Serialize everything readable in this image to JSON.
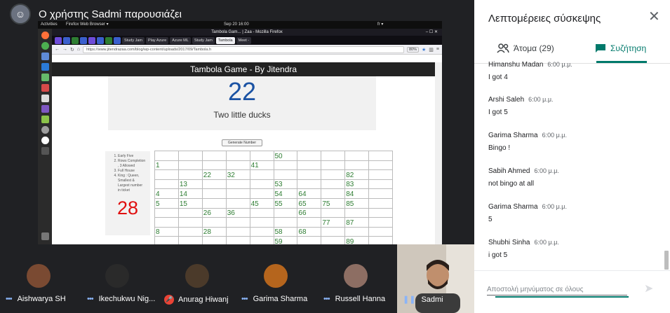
{
  "presenter": {
    "title": "Ο χρήστης Sadmi παρουσιάζει"
  },
  "desktop": {
    "activities": "Activities",
    "app_menu": "Firefox Web Browser ▾",
    "clock": "Sep 20  16:00",
    "lang": "fr ▾"
  },
  "browser": {
    "window_title": "Tambola Gam... | Zaa - Mozilla Firefox",
    "tabs": [
      "Study Jam",
      "Play Azure",
      "Azure ML",
      "Study Jam",
      "Tambola",
      "Meet - "
    ],
    "url": "https://www.jitendrazaa.com/blog/wp-content/uploads/2017/09/Tambola.h",
    "zoom": "80%"
  },
  "game": {
    "header": "Tambola Game - By Jitendra",
    "current_number": "22",
    "number_text": "Two little ducks",
    "generate_button": "Generate Number",
    "rules": [
      "Early Five",
      "Rows Completion , 3 Allowed",
      "Full House",
      "King : Queen, Smallest & Largest number in ticket"
    ],
    "last_number": "28",
    "grid": [
      [
        "",
        "",
        "",
        "",
        "",
        "50",
        "",
        "",
        "",
        ""
      ],
      [
        "1",
        "",
        "",
        "",
        "41",
        "",
        "",
        "",
        "",
        ""
      ],
      [
        "",
        "",
        "22",
        "32",
        "",
        "",
        "",
        "",
        "82",
        ""
      ],
      [
        "",
        "13",
        "",
        "",
        "",
        "53",
        "",
        "",
        "83",
        ""
      ],
      [
        "4",
        "14",
        "",
        "",
        "",
        "54",
        "64",
        "",
        "84",
        ""
      ],
      [
        "5",
        "15",
        "",
        "",
        "45",
        "55",
        "65",
        "75",
        "85",
        ""
      ],
      [
        "",
        "",
        "26",
        "36",
        "",
        "",
        "66",
        "",
        "",
        ""
      ],
      [
        "",
        "",
        "",
        "",
        "",
        "",
        "",
        "77",
        "87",
        ""
      ],
      [
        "8",
        "",
        "28",
        "",
        "",
        "58",
        "68",
        "",
        "",
        ""
      ],
      [
        "",
        "",
        "",
        "",
        "",
        "59",
        "",
        "",
        "89",
        ""
      ]
    ]
  },
  "participants": [
    {
      "name": "Aishwarya SH",
      "status": "dots",
      "color": "#7a4a32"
    },
    {
      "name": "Ikechukwu Nig...",
      "status": "dots",
      "color": "#2a2a2a"
    },
    {
      "name": "Anurag Hiwanj",
      "status": "mic-off",
      "color": "#4b3a2a"
    },
    {
      "name": "Garima Sharma",
      "status": "dots",
      "color": "#b5651d"
    },
    {
      "name": "Russell Hanna",
      "status": "dots",
      "color": "#8d6e63"
    },
    {
      "name": "Sadmi",
      "status": "speaking",
      "color": "#cfc7bc"
    }
  ],
  "sidebar": {
    "title": "Λεπτομέρειες σύσκεψης",
    "people_tab": "Άτομα (29)",
    "chat_tab": "Συζήτηση",
    "messages": [
      {
        "sender": "Himanshu Madan",
        "time": "6:00 μ.μ.",
        "text": "I got 4"
      },
      {
        "sender": "Arshi Saleh",
        "time": "6:00 μ.μ.",
        "text": "I got 5"
      },
      {
        "sender": "Garima Sharma",
        "time": "6:00 μ.μ.",
        "text": "Bingo !"
      },
      {
        "sender": "Sabih Ahmed",
        "time": "6:00 μ.μ.",
        "text": "not bingo at all"
      },
      {
        "sender": "Garima Sharma",
        "time": "6:00 μ.μ.",
        "text": "5"
      },
      {
        "sender": "Shubhi Sinha",
        "time": "6:00 μ.μ.",
        "text": "i got 5"
      }
    ],
    "input_placeholder": "Αποστολή μηνύματος σε όλους"
  }
}
